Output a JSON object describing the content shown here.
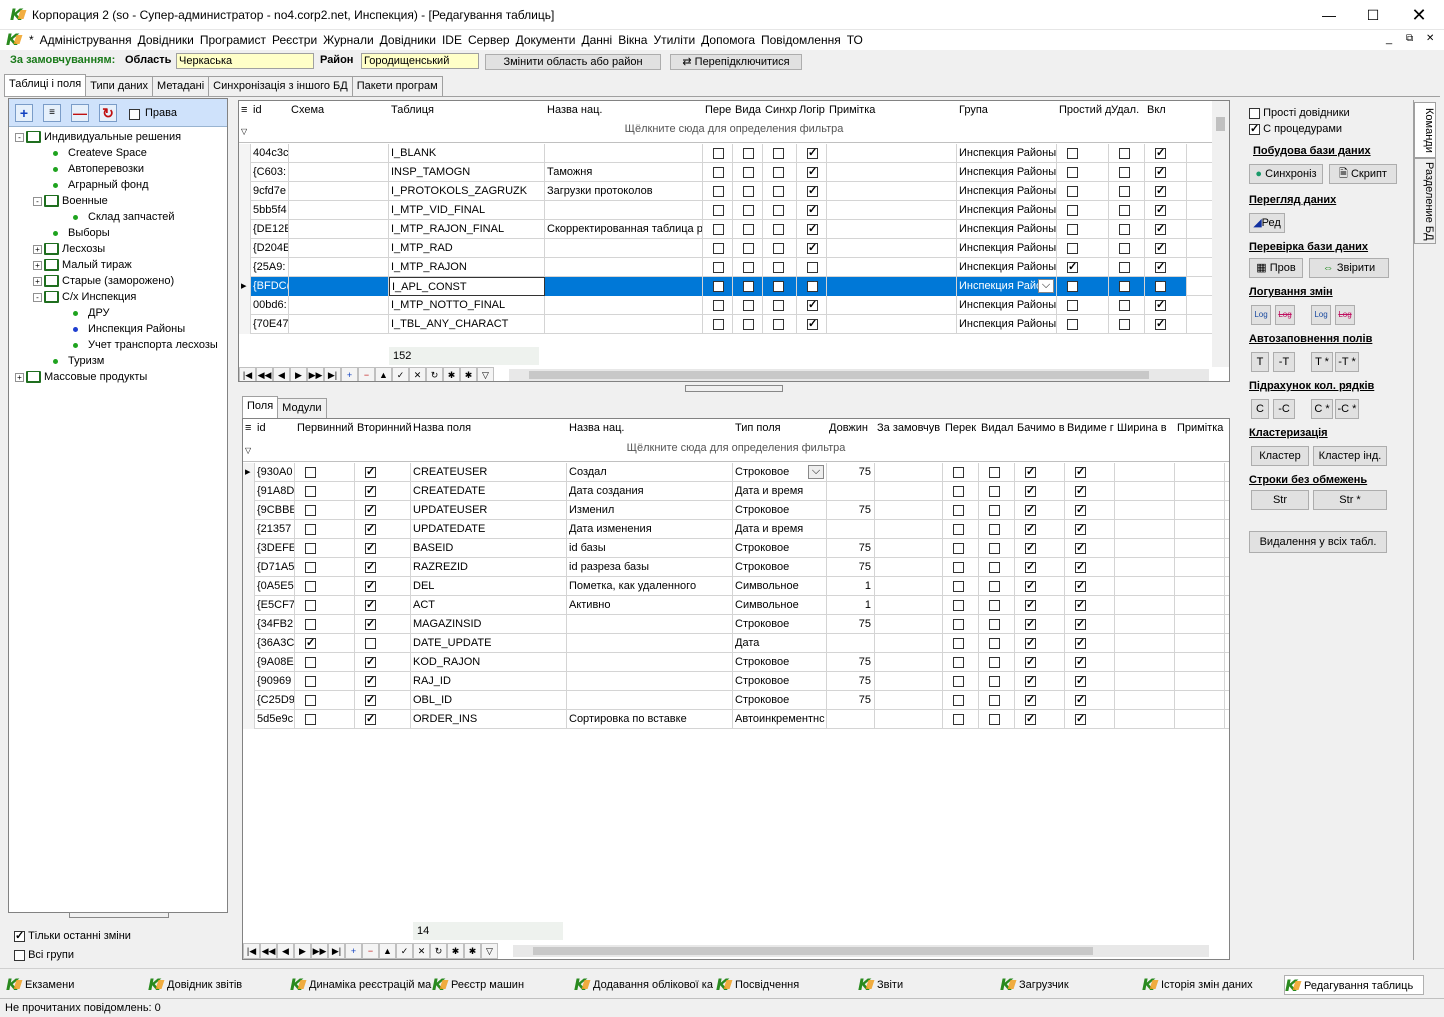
{
  "window": {
    "title": "Корпорация 2 (so - Супер-администратор - no4.corp2.net, Инспекция) - [Редагування таблиць]"
  },
  "menu": [
    "*",
    "Адміністрування",
    "Довідники",
    "Програмист",
    "Реєстри",
    "Журнали",
    "Довідники",
    "IDE",
    "Сервер",
    "Документи",
    "Данні",
    "Вікна",
    "Утиліти",
    "Допомога",
    "Повідомлення",
    "ТО"
  ],
  "context": {
    "label": "За замовчуванням:",
    "oblast_label": "Область",
    "oblast_value": "Черкаська",
    "rayon_label": "Район",
    "rayon_value": "Городищенський",
    "change_button": "Змінити область або район",
    "reconnect_button": "Перепідключитися"
  },
  "tabs": [
    "Таблиці і поля",
    "Типи даних",
    "Метадані",
    "Синхронізація з іншого БД",
    "Пакети програм"
  ],
  "tree_toolbar": {
    "rights_label": "Права"
  },
  "tree": [
    {
      "label": "Индивидуальные решения",
      "level": 0,
      "type": "folder",
      "exp": "-"
    },
    {
      "label": "Createve Space",
      "level": 1,
      "type": "leaf",
      "color": "green"
    },
    {
      "label": "Автоперевозки",
      "level": 1,
      "type": "leaf",
      "color": "green"
    },
    {
      "label": "Аграрный фонд",
      "level": 1,
      "type": "leaf",
      "color": "green"
    },
    {
      "label": "Военные",
      "level": 1,
      "type": "folder",
      "exp": "-"
    },
    {
      "label": "Склад запчастей",
      "level": 2,
      "type": "leaf",
      "color": "green"
    },
    {
      "label": "Выборы",
      "level": 1,
      "type": "leaf",
      "color": "green"
    },
    {
      "label": "Лесхозы",
      "level": 1,
      "type": "folder",
      "exp": "+"
    },
    {
      "label": "Малый тираж",
      "level": 1,
      "type": "folder",
      "exp": "+"
    },
    {
      "label": "Старые (заморожено)",
      "level": 1,
      "type": "folder",
      "exp": "+"
    },
    {
      "label": "С/х Инспекция",
      "level": 1,
      "type": "folder",
      "exp": "-"
    },
    {
      "label": "ДРУ",
      "level": 2,
      "type": "leaf",
      "color": "green"
    },
    {
      "label": "Инспекция Районы",
      "level": 2,
      "type": "leaf",
      "color": "blue"
    },
    {
      "label": "Учет транспорта лесхозы",
      "level": 2,
      "type": "leaf",
      "color": "green"
    },
    {
      "label": "Туризм",
      "level": 1,
      "type": "leaf",
      "color": "green"
    },
    {
      "label": "Массовые продукты",
      "level": 0,
      "type": "folder",
      "exp": "+"
    }
  ],
  "left_bottom": {
    "only_last_changes": "Тільки останні зміни",
    "all_groups": "Всі групи"
  },
  "tables_grid": {
    "headers": [
      "id",
      "Схема",
      "Таблиця",
      "Назва нац.",
      "Пере",
      "Вида",
      "Синхр",
      "Логір",
      "Примітка",
      "Група",
      "Простий д",
      "Удал.",
      "Вкл"
    ],
    "filter_hint": "Щёлкните сюда для определения фильтра",
    "rows": [
      {
        "id": "404c3c",
        "schema": "",
        "table": "I_BLANK",
        "name": "",
        "c1": false,
        "c2": false,
        "c3": false,
        "c4": true,
        "note": "",
        "group": "Инспекция Районы",
        "c5": false,
        "c6": false,
        "c7": true
      },
      {
        "id": "{C603:",
        "schema": "",
        "table": "INSP_TAMOGN",
        "name": "Таможня",
        "c1": false,
        "c2": false,
        "c3": false,
        "c4": true,
        "note": "",
        "group": "Инспекция Районы",
        "c5": false,
        "c6": false,
        "c7": true
      },
      {
        "id": "9cfd7e",
        "schema": "",
        "table": "I_PROTOKOLS_ZAGRUZK",
        "name": "Загрузки протоколов",
        "c1": false,
        "c2": false,
        "c3": false,
        "c4": true,
        "note": "",
        "group": "Инспекция Районы",
        "c5": false,
        "c6": false,
        "c7": true
      },
      {
        "id": "5bb5f4",
        "schema": "",
        "table": "I_MTP_VID_FINAL",
        "name": "",
        "c1": false,
        "c2": false,
        "c3": false,
        "c4": true,
        "note": "",
        "group": "Инспекция Районы",
        "c5": false,
        "c6": false,
        "c7": true
      },
      {
        "id": "{DE12E",
        "schema": "",
        "table": "I_MTP_RAJON_FINAL",
        "name": "Скорректированная таблица р",
        "c1": false,
        "c2": false,
        "c3": false,
        "c4": true,
        "note": "",
        "group": "Инспекция Районы",
        "c5": false,
        "c6": false,
        "c7": true
      },
      {
        "id": "{D204E",
        "schema": "",
        "table": "I_MTP_RAD",
        "name": "",
        "c1": false,
        "c2": false,
        "c3": false,
        "c4": true,
        "note": "",
        "group": "Инспекция Районы",
        "c5": false,
        "c6": false,
        "c7": true
      },
      {
        "id": "{25A9:",
        "schema": "",
        "table": "I_MTP_RAJON",
        "name": "",
        "c1": false,
        "c2": false,
        "c3": false,
        "c4": false,
        "note": "",
        "group": "Инспекция Районы",
        "c5": true,
        "c6": false,
        "c7": true
      },
      {
        "id": "{BFDC(",
        "schema": "",
        "table": "I_APL_CONST",
        "name": "",
        "c1": false,
        "c2": false,
        "c3": false,
        "c4": true,
        "note": "",
        "group": "Инспекция Райо",
        "c5": false,
        "c6": false,
        "c7": true,
        "selected": true
      },
      {
        "id": "00bd6:",
        "schema": "",
        "table": "I_MTP_NOTTO_FINAL",
        "name": "",
        "c1": false,
        "c2": false,
        "c3": false,
        "c4": true,
        "note": "",
        "group": "Инспекция Районы",
        "c5": false,
        "c6": false,
        "c7": true
      },
      {
        "id": "{70E47",
        "schema": "",
        "table": "I_TBL_ANY_CHARACT",
        "name": "",
        "c1": false,
        "c2": false,
        "c3": false,
        "c4": true,
        "note": "",
        "group": "Инспекция Районы",
        "c5": false,
        "c6": false,
        "c7": true
      }
    ],
    "count": "152"
  },
  "fields_tabs": [
    "Поля",
    "Модули"
  ],
  "fields_grid": {
    "headers": [
      "id",
      "Первинний",
      "Вторинний",
      "Назва поля",
      "Назва нац.",
      "Тип поля",
      "Довжин",
      "За замовчув",
      "Перек",
      "Видал",
      "Бачимо в",
      "Видиме г",
      "Ширина в",
      "Примітка"
    ],
    "filter_hint": "Щёлкните сюда для определения фильтра",
    "rows": [
      {
        "id": "{930A0",
        "p": false,
        "s": true,
        "field": "CREATEUSER",
        "name": "Создал",
        "type": "Строковое",
        "len": "75",
        "c1": false,
        "c2": false,
        "c3": true,
        "c4": true
      },
      {
        "id": "{91A8D",
        "p": false,
        "s": true,
        "field": "CREATEDATE",
        "name": "Дата создания",
        "type": "Дата и время",
        "len": "",
        "c1": false,
        "c2": false,
        "c3": true,
        "c4": true
      },
      {
        "id": "{9CBBE",
        "p": false,
        "s": true,
        "field": "UPDATEUSER",
        "name": "Изменил",
        "type": "Строковое",
        "len": "75",
        "c1": false,
        "c2": false,
        "c3": true,
        "c4": true
      },
      {
        "id": "{21357",
        "p": false,
        "s": true,
        "field": "UPDATEDATE",
        "name": "Дата изменения",
        "type": "Дата и время",
        "len": "",
        "c1": false,
        "c2": false,
        "c3": true,
        "c4": true
      },
      {
        "id": "{3DEFE",
        "p": false,
        "s": true,
        "field": "BASEID",
        "name": "id базы",
        "type": "Строковое",
        "len": "75",
        "c1": false,
        "c2": false,
        "c3": true,
        "c4": true
      },
      {
        "id": "{D71A5",
        "p": false,
        "s": true,
        "field": "RAZREZID",
        "name": "id разреза базы",
        "type": "Строковое",
        "len": "75",
        "c1": false,
        "c2": false,
        "c3": true,
        "c4": true
      },
      {
        "id": "{0A5E5",
        "p": false,
        "s": true,
        "field": "DEL",
        "name": "Пометка, как удаленного",
        "type": "Символьное",
        "len": "1",
        "c1": false,
        "c2": false,
        "c3": true,
        "c4": true
      },
      {
        "id": "{E5CF7",
        "p": false,
        "s": true,
        "field": "ACT",
        "name": "Активно",
        "type": "Символьное",
        "len": "1",
        "c1": false,
        "c2": false,
        "c3": true,
        "c4": true
      },
      {
        "id": "{34FB2",
        "p": false,
        "s": true,
        "field": "MAGAZINSID",
        "name": "",
        "type": "Строковое",
        "len": "75",
        "c1": false,
        "c2": false,
        "c3": true,
        "c4": true
      },
      {
        "id": "{36A3C",
        "p": true,
        "s": false,
        "field": "DATE_UPDATE",
        "name": "",
        "type": "Дата",
        "len": "",
        "c1": false,
        "c2": false,
        "c3": true,
        "c4": true
      },
      {
        "id": "{9A08E",
        "p": false,
        "s": true,
        "field": "KOD_RAJON",
        "name": "",
        "type": "Строковое",
        "len": "75",
        "c1": false,
        "c2": false,
        "c3": true,
        "c4": true
      },
      {
        "id": "{90969",
        "p": false,
        "s": true,
        "field": "RAJ_ID",
        "name": "",
        "type": "Строковое",
        "len": "75",
        "c1": false,
        "c2": false,
        "c3": true,
        "c4": true
      },
      {
        "id": "{C25D9",
        "p": false,
        "s": true,
        "field": "OBL_ID",
        "name": "",
        "type": "Строковое",
        "len": "75",
        "c1": false,
        "c2": false,
        "c3": true,
        "c4": true
      },
      {
        "id": "5d5e9c",
        "p": false,
        "s": true,
        "field": "ORDER_INS",
        "name": "Сортировка по вставке",
        "type": "Автоинкрементнс",
        "len": "",
        "c1": false,
        "c2": false,
        "c3": true,
        "c4": true
      }
    ],
    "count": "14"
  },
  "right": {
    "simple_dirs": "Прості довідники",
    "with_procs": "С процедурами",
    "build_db": "Побудова бази даних",
    "sync_btn": "Синхроніз",
    "script_btn": "Скрипт",
    "view_data": "Перегляд даних",
    "red_btn": "Ред",
    "check_db": "Перевірка бази даних",
    "prov_btn": "Пров",
    "compare_btn": "Звірити",
    "log_changes": "Логування змін",
    "log1": "Log",
    "log2": "Log",
    "log3": "Log",
    "log4": "Log",
    "autofill": "Автозаповнення полів",
    "t1": "T",
    "t2": "-T",
    "t3": "T *",
    "t4": "-T *",
    "count_rows": "Підрахунок кол. рядків",
    "c1": "C",
    "c2": "-C",
    "c3": "C *",
    "c4": "-C *",
    "cluster": "Кластеризація",
    "cluster_btn": "Кластер",
    "cluster_idx_btn": "Кластер інд.",
    "unlimited": "Строки без обмежень",
    "str1": "Str",
    "str2": "Str *",
    "delete_all": "Видалення у всіх табл."
  },
  "vtabs": [
    "Команди",
    "Разделение БД"
  ],
  "taskbar": [
    "Екзамени",
    "Довідник звітів",
    "Динаміка реєстрацій ма",
    "Реєстр машин",
    "Додавання облікової ка",
    "Посвідчення",
    "Звіти",
    "Загрузчик",
    "Історія змін даних",
    "Редагування таблиць"
  ],
  "status": "Не прочитаних повідомлень: 0"
}
